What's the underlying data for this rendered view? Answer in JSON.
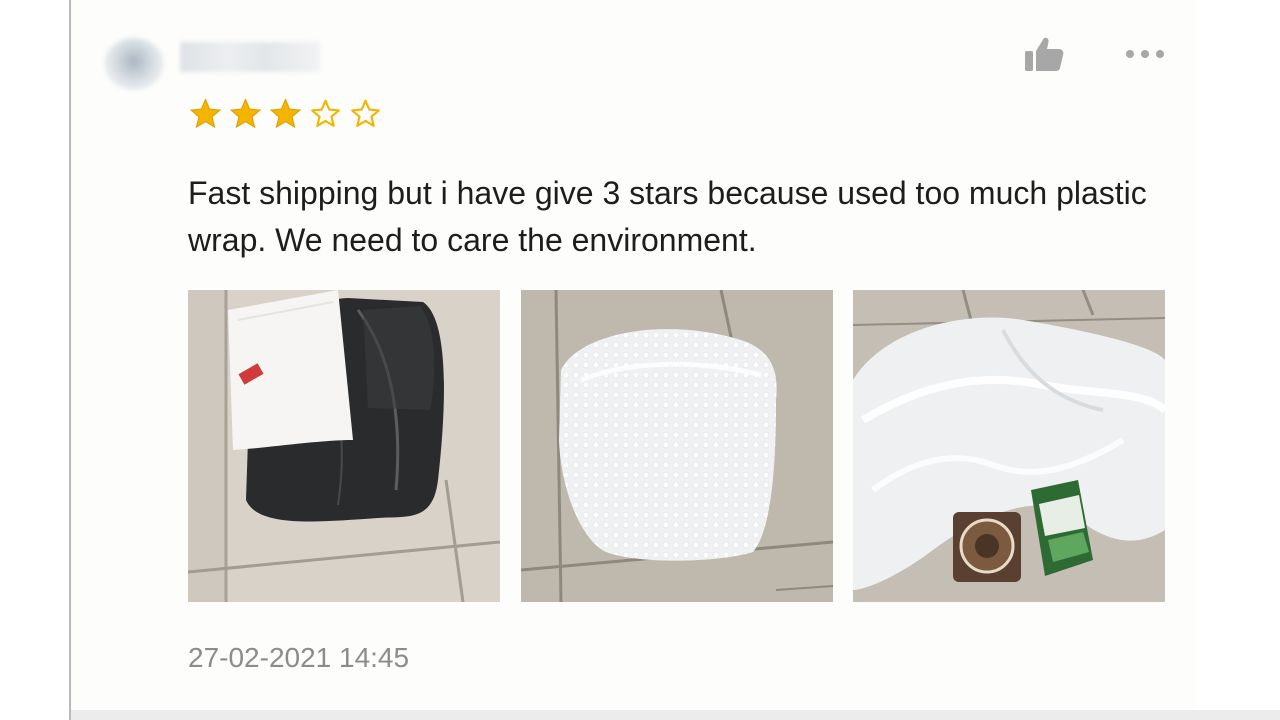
{
  "review": {
    "username": "...",
    "rating": 3,
    "max_rating": 5,
    "text": "Fast shipping but i have give 3 stars because used too much plastic wrap. We need to care the environment.",
    "timestamp": "27-02-2021 14:45",
    "photos": [
      {
        "icon": "black-package-with-label-photo"
      },
      {
        "icon": "bubble-wrap-package-photo"
      },
      {
        "icon": "unwrapped-plastic-with-products-photo"
      }
    ]
  },
  "icons": {
    "like": "thumbs-up-icon",
    "more": "more-dots-icon",
    "star_filled": "star-filled-icon",
    "star_empty": "star-empty-icon"
  },
  "colors": {
    "star": "#f5b400",
    "text": "#1d1d1d",
    "timestamp": "#8c8c8c",
    "icon": "#a7a7a7"
  }
}
